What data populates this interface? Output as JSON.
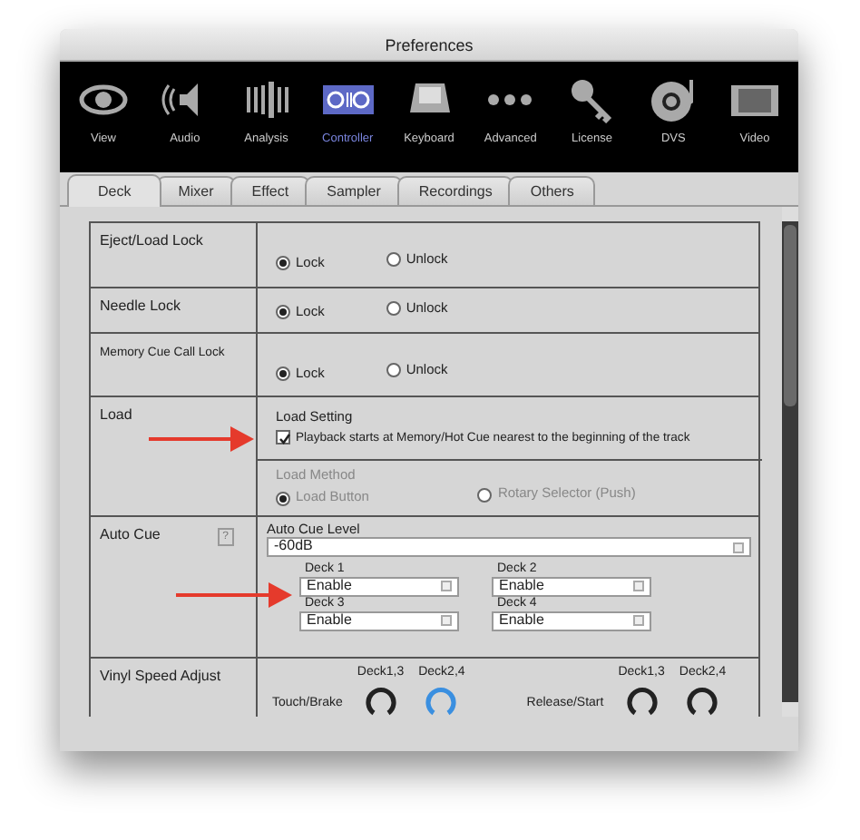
{
  "window": {
    "title": "Preferences"
  },
  "toolbar": [
    {
      "label": "View",
      "selected": false
    },
    {
      "label": "Audio",
      "selected": false
    },
    {
      "label": "Analysis",
      "selected": false
    },
    {
      "label": "Controller",
      "selected": true
    },
    {
      "label": "Keyboard",
      "selected": false
    },
    {
      "label": "Advanced",
      "selected": false
    },
    {
      "label": "License",
      "selected": false
    },
    {
      "label": "DVS",
      "selected": false
    },
    {
      "label": "Video",
      "selected": false
    }
  ],
  "tabs": [
    {
      "label": "Deck",
      "selected": true
    },
    {
      "label": "Mixer",
      "selected": false
    },
    {
      "label": "Effect",
      "selected": false
    },
    {
      "label": "Sampler",
      "selected": false
    },
    {
      "label": "Recordings",
      "selected": false
    },
    {
      "label": "Others",
      "selected": false
    }
  ],
  "settings": [
    {
      "kind": "radio",
      "label": "Eject/Load Lock",
      "small_label": false,
      "options": [
        {
          "label": "Lock",
          "selected": true
        },
        {
          "label": "Unlock",
          "selected": false
        }
      ]
    },
    {
      "kind": "radio",
      "label": "Needle Lock",
      "small_label": false,
      "options": [
        {
          "label": "Lock",
          "selected": true
        },
        {
          "label": "Unlock",
          "selected": false
        }
      ]
    },
    {
      "kind": "radio",
      "label": "Memory Cue Call Lock",
      "small_label": true,
      "options": [
        {
          "label": "Lock",
          "selected": true
        },
        {
          "label": "Unlock",
          "selected": false
        }
      ]
    },
    {
      "kind": "load",
      "label": "Load",
      "arrow": true,
      "setting_title": "Load Setting",
      "checkbox": {
        "label": "Playback starts at Memory/Hot Cue nearest to the beginning of the track",
        "checked": true
      },
      "method_title": "Load Method",
      "method_disabled": true,
      "options": [
        {
          "label": "Load Button",
          "selected": true
        },
        {
          "label": "Rotary Selector (Push)",
          "selected": false
        }
      ]
    },
    {
      "kind": "autocue",
      "label": "Auto Cue",
      "arrow": true,
      "help": "?",
      "level_title": "Auto Cue Level",
      "level_value": "-60dB",
      "decks": [
        {
          "label": "Deck 1",
          "value": "Enable"
        },
        {
          "label": "Deck 2",
          "value": "Enable"
        },
        {
          "label": "Deck 3",
          "value": "Enable"
        },
        {
          "label": "Deck 4",
          "value": "Enable"
        }
      ]
    },
    {
      "kind": "knobs",
      "label": "Vinyl Speed Adjust",
      "groups": [
        {
          "label": "Touch/Brake",
          "knobs": [
            {
              "label": "Deck1,3",
              "active": false
            },
            {
              "label": "Deck2,4",
              "active": true
            }
          ]
        },
        {
          "label": "Release/Start",
          "knobs": [
            {
              "label": "Deck1,3",
              "active": false
            },
            {
              "label": "Deck2,4",
              "active": false
            }
          ]
        }
      ]
    }
  ]
}
